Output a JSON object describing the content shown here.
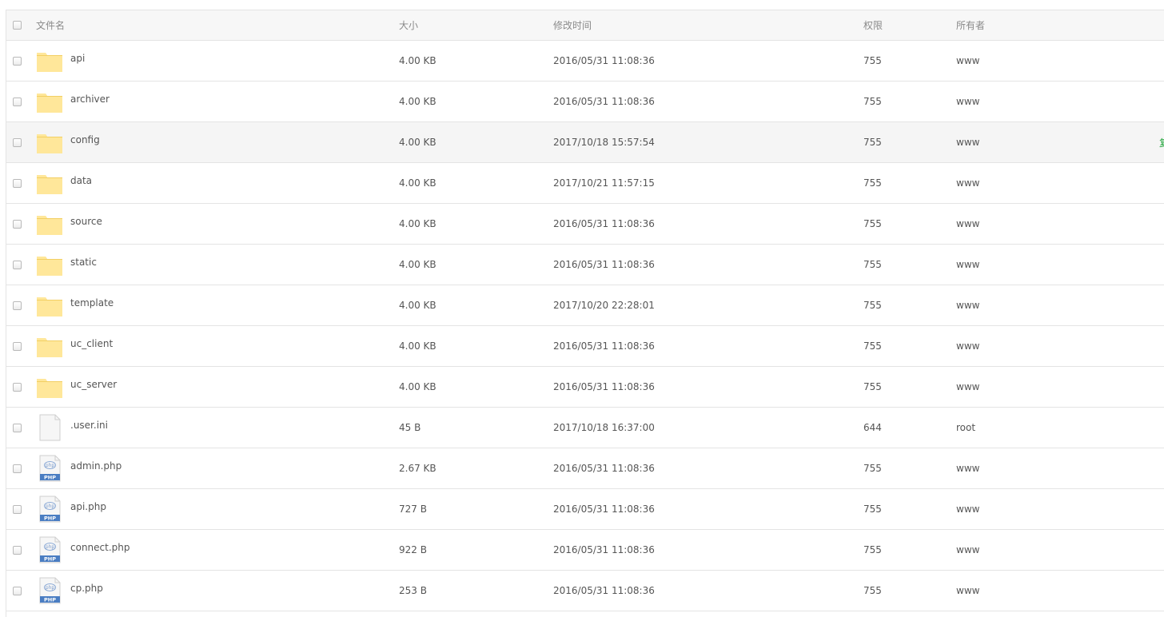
{
  "header": {
    "name": "文件名",
    "size": "大小",
    "mtime": "修改时间",
    "perm": "权限",
    "owner": "所有者"
  },
  "rows": [
    {
      "name": "api",
      "type": "folder",
      "size": "4.00 KB",
      "mtime": "2016/05/31 11:08:36",
      "perm": "755",
      "owner": "www"
    },
    {
      "name": "archiver",
      "type": "folder",
      "size": "4.00 KB",
      "mtime": "2016/05/31 11:08:36",
      "perm": "755",
      "owner": "www"
    },
    {
      "name": "config",
      "type": "folder",
      "size": "4.00 KB",
      "mtime": "2017/10/18 15:57:54",
      "perm": "755",
      "owner": "www",
      "op": "复"
    },
    {
      "name": "data",
      "type": "folder",
      "size": "4.00 KB",
      "mtime": "2017/10/21 11:57:15",
      "perm": "755",
      "owner": "www"
    },
    {
      "name": "source",
      "type": "folder",
      "size": "4.00 KB",
      "mtime": "2016/05/31 11:08:36",
      "perm": "755",
      "owner": "www"
    },
    {
      "name": "static",
      "type": "folder",
      "size": "4.00 KB",
      "mtime": "2016/05/31 11:08:36",
      "perm": "755",
      "owner": "www"
    },
    {
      "name": "template",
      "type": "folder",
      "size": "4.00 KB",
      "mtime": "2017/10/20 22:28:01",
      "perm": "755",
      "owner": "www"
    },
    {
      "name": "uc_client",
      "type": "folder",
      "size": "4.00 KB",
      "mtime": "2016/05/31 11:08:36",
      "perm": "755",
      "owner": "www"
    },
    {
      "name": "uc_server",
      "type": "folder",
      "size": "4.00 KB",
      "mtime": "2016/05/31 11:08:36",
      "perm": "755",
      "owner": "www"
    },
    {
      "name": ".user.ini",
      "type": "file",
      "size": "45 B",
      "mtime": "2017/10/18 16:37:00",
      "perm": "644",
      "owner": "root"
    },
    {
      "name": "admin.php",
      "type": "php",
      "size": "2.67 KB",
      "mtime": "2016/05/31 11:08:36",
      "perm": "755",
      "owner": "www"
    },
    {
      "name": "api.php",
      "type": "php",
      "size": "727 B",
      "mtime": "2016/05/31 11:08:36",
      "perm": "755",
      "owner": "www"
    },
    {
      "name": "connect.php",
      "type": "php",
      "size": "922 B",
      "mtime": "2016/05/31 11:08:36",
      "perm": "755",
      "owner": "www"
    },
    {
      "name": "cp.php",
      "type": "php",
      "size": "253 B",
      "mtime": "2016/05/31 11:08:36",
      "perm": "755",
      "owner": "www"
    }
  ],
  "hovered_row": 2,
  "icons": {
    "folder": "folder-icon",
    "file": "file-icon",
    "php": "php-file-icon",
    "php_badge": "PHP",
    "php_glyph": "php"
  },
  "colors": {
    "folder": "#ffe79a",
    "folder_edge": "#f2cf63",
    "php_badge": "#4a7dc2",
    "accent": "#20a53a"
  }
}
